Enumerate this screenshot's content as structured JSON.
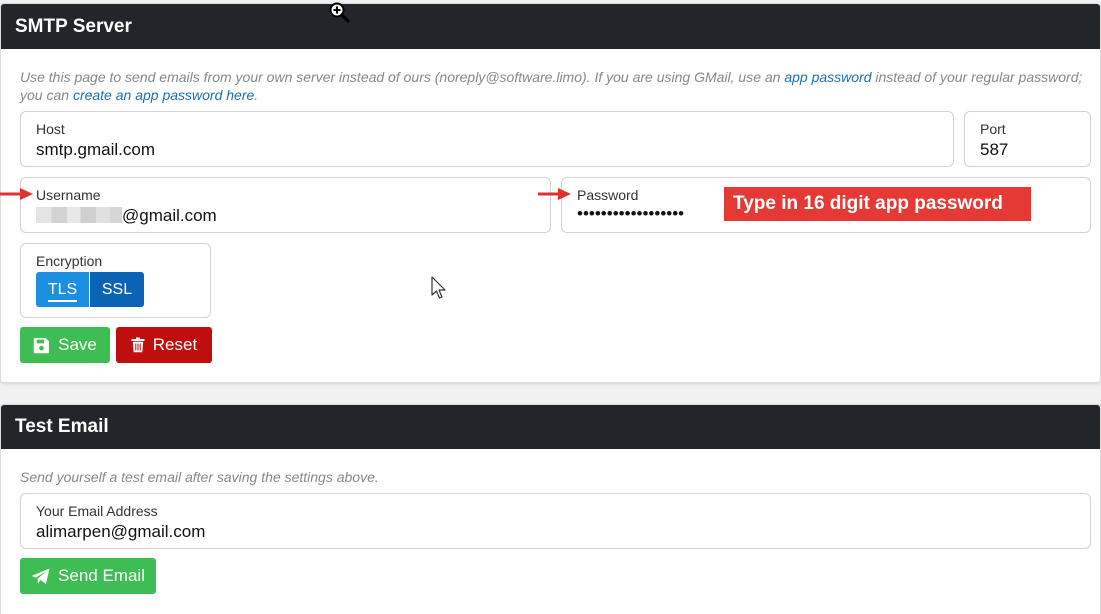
{
  "smtp": {
    "title": "SMTP Server",
    "desc_part1": "Use this page to send emails from your own server instead of ours (noreply@software.limo). If you are using GMail, use an ",
    "desc_link1": "app password",
    "desc_part2": " instead of your regular password; you can ",
    "desc_link2": "create an app password here",
    "desc_part3": ".",
    "host_label": "Host",
    "host_value": "smtp.gmail.com",
    "port_label": "Port",
    "port_value": "587",
    "username_label": "Username",
    "username_suffix": "@gmail.com",
    "password_label": "Password",
    "password_value": "••••••••••••••••••",
    "annotation": "Type in 16 digit app password",
    "encryption_label": "Encryption",
    "enc_tls": "TLS",
    "enc_ssl": "SSL",
    "save_label": "Save",
    "reset_label": "Reset"
  },
  "test": {
    "title": "Test Email",
    "desc": "Send yourself a test email after saving the settings above.",
    "email_label": "Your Email Address",
    "email_value": "alimarpen@gmail.com",
    "send_label": "Send Email"
  },
  "colors": {
    "header_bg": "#22252a",
    "link": "#1a6fb5",
    "save_green": "#3dbd52",
    "reset_red": "#c00d0d",
    "tls_blue": "#1d8fe0",
    "ssl_blue": "#0b63b5",
    "annotation_red": "#e53935"
  },
  "icons": [
    "zoom-in-icon",
    "floppy-disk-icon",
    "trash-icon",
    "paper-plane-icon",
    "mouse-pointer-icon",
    "red-arrow-icon"
  ]
}
